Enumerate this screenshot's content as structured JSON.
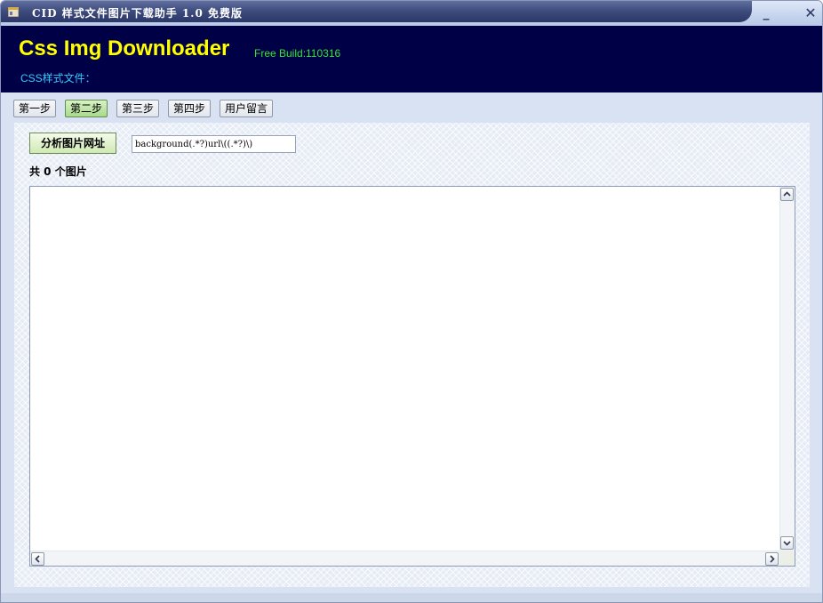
{
  "window": {
    "title": "CID 样式文件图片下载助手 1.0 免费版",
    "minimize_label": "_",
    "close_label": "✕"
  },
  "banner": {
    "app_name": "Css Img Downloader",
    "build": "Free Build:110316",
    "css_file_label": "CSS样式文件："
  },
  "steps": [
    {
      "label": "第一步",
      "active": false
    },
    {
      "label": "第二步",
      "active": true
    },
    {
      "label": "第三步",
      "active": false
    },
    {
      "label": "第四步",
      "active": false
    },
    {
      "label": "用户留言",
      "active": false
    }
  ],
  "analyze": {
    "button_label": "分析图片网址",
    "regex_value": "background(.*?)url\\((.*?)\\)"
  },
  "result": {
    "count_label": "共 0 个图片"
  },
  "colors": {
    "banner_bg": "#000046",
    "app_name": "#ffff00",
    "build": "#33e233",
    "css_label": "#33ccff"
  },
  "icons": {
    "app": "app-window-icon",
    "scroll_up": "arrow-up-icon",
    "scroll_down": "arrow-down-icon",
    "scroll_left": "arrow-left-icon",
    "scroll_right": "arrow-right-icon"
  }
}
